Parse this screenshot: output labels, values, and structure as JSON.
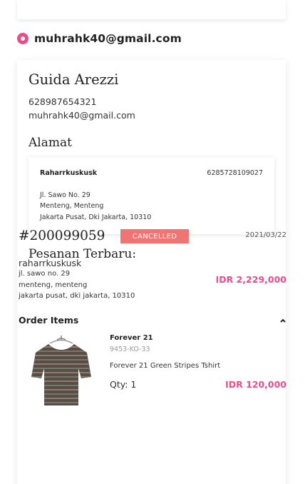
{
  "account": {
    "email": "muhrahk40@gmail.com"
  },
  "profile": {
    "name": "Guida Arezzi",
    "phone": "628987654321",
    "email": "muhrahk40@gmail.com"
  },
  "address_section": {
    "heading": "Alamat",
    "recipient": "Raharrkuskusk",
    "phone": "6285728109027",
    "lines": [
      "Jl. Sawo No. 29",
      "Menteng, Menteng",
      "Jakarta Pusat, Dki Jakarta, 10310"
    ]
  },
  "orders_section": {
    "heading": "Pesanan Terbaru:"
  },
  "order": {
    "id": "#200099059",
    "status": "CANCELLED",
    "status_color": "#f07572",
    "date": "2021/03/22",
    "ship_name": "raharrkuskusk",
    "ship_lines": [
      "jl. sawo no. 29",
      "menteng, menteng",
      "jakarta pusat, dki jakarta, 10310"
    ],
    "total": "IDR 2,229,000",
    "items_title": "Order Items",
    "items": [
      {
        "brand": "Forever 21",
        "sku": "9453-KO-33",
        "name": "Forever 21 Green Stripes Tshirt",
        "qty": "Qty: 1",
        "price": "IDR 120,000"
      }
    ]
  },
  "colors": {
    "accent": "#e84c8b",
    "cancelled": "#f07572"
  },
  "icons": {
    "selected": "radio-selected-icon",
    "collapse": "chevron-up-icon"
  }
}
